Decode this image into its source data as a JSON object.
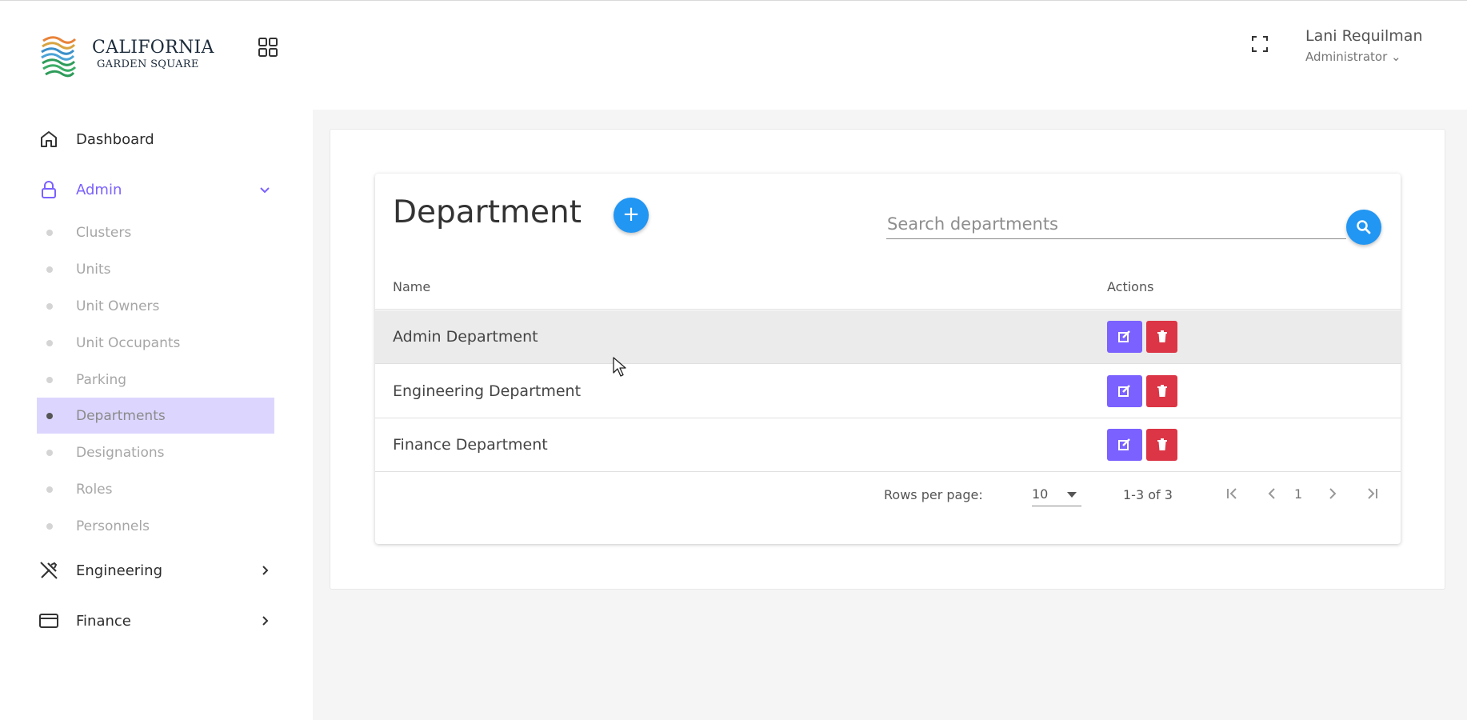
{
  "brand": {
    "line1": "CALIFORNIA",
    "line2": "GARDEN SQUARE"
  },
  "header": {
    "user_name": "Lani Requilman",
    "user_role": "Administrator ⌄"
  },
  "sidebar": {
    "dashboard": "Dashboard",
    "admin": "Admin",
    "admin_items": [
      "Clusters",
      "Units",
      "Unit Owners",
      "Unit Occupants",
      "Parking",
      "Departments",
      "Designations",
      "Roles",
      "Personnels"
    ],
    "active_item": "Departments",
    "engineering": "Engineering",
    "finance": "Finance"
  },
  "page": {
    "title": "Department",
    "search_placeholder": "Search departments",
    "columns": [
      "Name",
      "Actions"
    ],
    "rows": [
      "Admin Department",
      "Engineering Department",
      "Finance Department"
    ],
    "rows_per_page_label": "Rows per page:",
    "rows_per_page_value": "10",
    "range": "1-3 of 3",
    "current_page": "1"
  },
  "colors": {
    "accent": "#7b61ff",
    "primary_blue": "#2196f3",
    "danger": "#dc3545",
    "active_bg": "#dcd6ff"
  },
  "icons": [
    "grid-icon",
    "home-icon",
    "lock-icon",
    "chevron-down-icon",
    "tools-icon",
    "card-icon",
    "chevron-right-icon",
    "fullscreen-icon",
    "plus-icon",
    "search-icon",
    "edit-icon",
    "trash-icon",
    "first-page-icon",
    "prev-page-icon",
    "next-page-icon",
    "last-page-icon"
  ]
}
